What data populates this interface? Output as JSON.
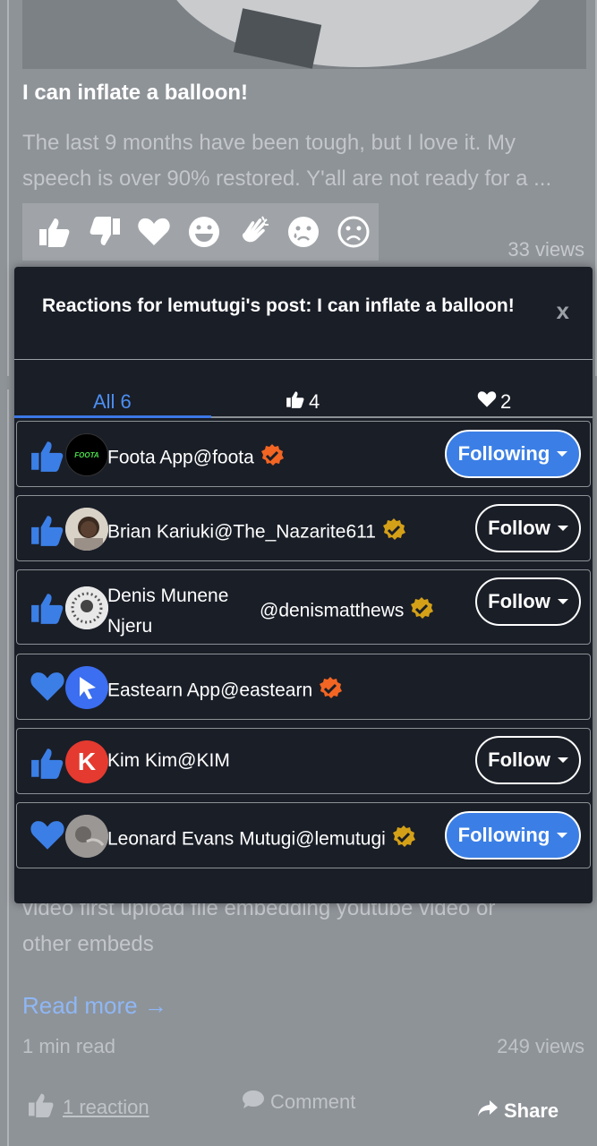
{
  "post": {
    "title": "I can inflate a balloon!",
    "excerpt": "The last 9 months have been tough, but I love it. My speech is over 90% restored. Y'all are not ready for a ...",
    "views": "33 views",
    "reaction_icons": [
      "thumbs-up-icon",
      "thumbs-down-icon",
      "heart-icon",
      "grin-icon",
      "clap-icon",
      "sad-tear-icon",
      "frown-icon"
    ]
  },
  "modal": {
    "title": "Reactions for lemutugi's post: I can inflate a balloon!",
    "close": "x",
    "tabs": {
      "all": "All 6",
      "likes": "4",
      "hearts": "2"
    },
    "users": [
      {
        "reaction": "thumbs-up-icon",
        "name": "Foota App",
        "handle": "@foota",
        "badge": "orange",
        "button": "Following",
        "avatar_text": "FOOTA"
      },
      {
        "reaction": "thumbs-up-icon",
        "name": "Brian Kariuki",
        "handle": "@The_Nazarite611",
        "badge": "gold",
        "button": "Follow"
      },
      {
        "reaction": "thumbs-up-icon",
        "name_line1": "Denis Munene",
        "name_line2": "Njeru",
        "handle": "@denismatthews",
        "badge": "gold",
        "button": "Follow"
      },
      {
        "reaction": "heart-icon",
        "name": "Eastearn App",
        "handle": "@eastearn",
        "badge": "orange",
        "button": ""
      },
      {
        "reaction": "thumbs-up-icon",
        "name": "Kim Kim",
        "handle": "@KIM",
        "badge": "",
        "button": "Follow",
        "avatar_text": "K"
      },
      {
        "reaction": "heart-icon",
        "name": "Leonard Evans Mutugi",
        "handle": "@lemutugi",
        "badge": "gold",
        "button": "Following"
      }
    ]
  },
  "next_post": {
    "excerpt_line1": "video first upload file embedding youtube video or",
    "excerpt_line2": "other embeds",
    "read_more": "Read more →",
    "read_time": "1 min read",
    "views": "249 views",
    "reaction_label": "1 reaction",
    "comment_label": "Comment",
    "share_label": "Share"
  },
  "colors": {
    "accent": "#3b7fe6",
    "modal_bg": "#1a1e27",
    "badge_orange": "#f26522",
    "badge_gold": "#d4a017"
  }
}
